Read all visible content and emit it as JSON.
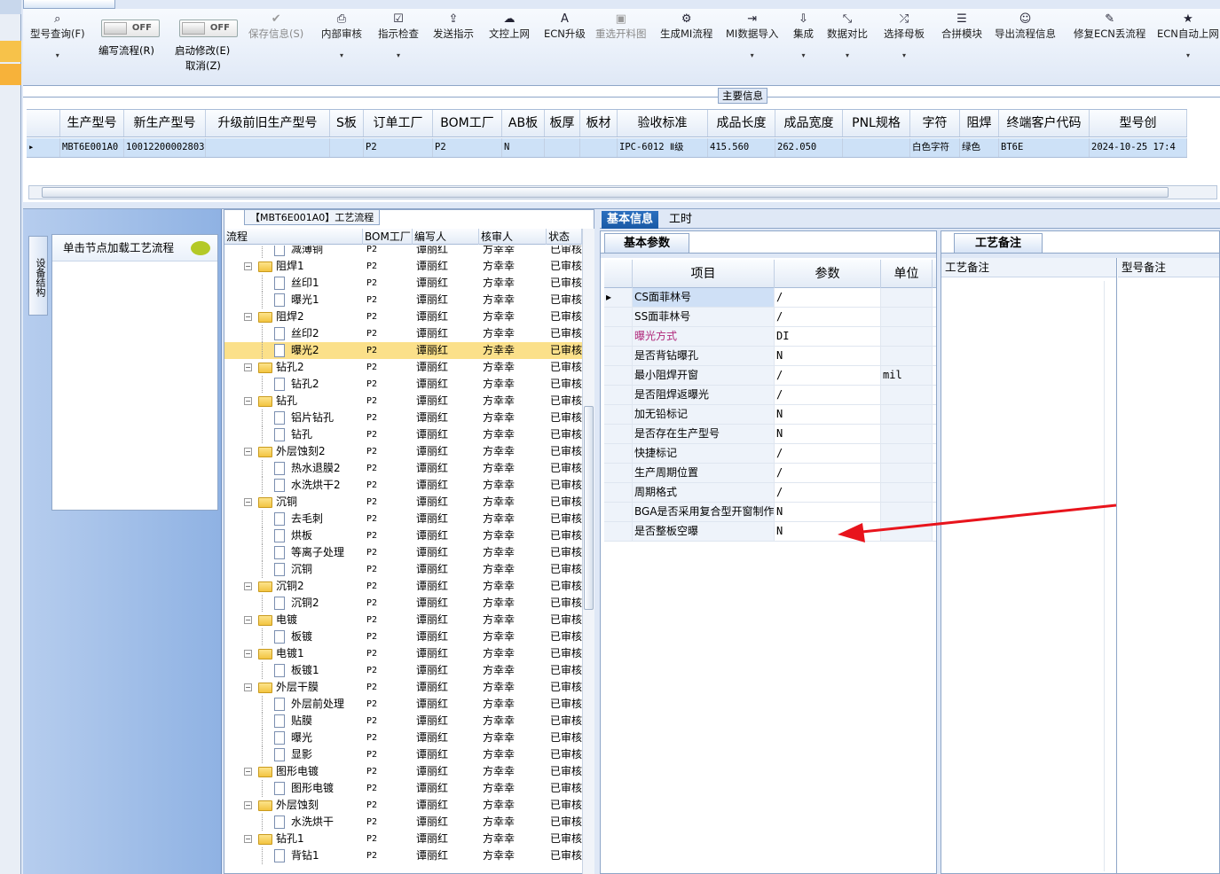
{
  "doc_tab": {
    "title": "",
    "close": "×"
  },
  "toolbar": {
    "items": [
      {
        "label": "型号查询(F)",
        "icon": "search-icon",
        "dropdown": true
      },
      {
        "label": "保存信息(S)",
        "icon": "check-icon",
        "disabled": true
      },
      {
        "label": "内部审核",
        "icon": "print-icon",
        "dropdown": true
      },
      {
        "label": "指示检查",
        "icon": "checkbox-icon",
        "dropdown": true
      },
      {
        "label": "发送指示",
        "icon": "upload-icon"
      },
      {
        "label": "文控上网",
        "icon": "cloud-upload-icon"
      },
      {
        "label": "ECN升级",
        "icon": "font-a-icon"
      },
      {
        "label": "重选开料图",
        "icon": "image-icon",
        "disabled": true
      },
      {
        "label": "生成MI流程",
        "icon": "cogs-icon"
      },
      {
        "label": "MI数据导入",
        "icon": "import-icon",
        "dropdown": true
      },
      {
        "label": "集成",
        "icon": "download-icon",
        "dropdown": true
      },
      {
        "label": "数据对比",
        "icon": "compress-icon",
        "dropdown": true
      },
      {
        "label": "选择母板",
        "icon": "shuffle-icon",
        "dropdown": true
      },
      {
        "label": "合拼模块",
        "icon": "list-icon"
      },
      {
        "label": "导出流程信息",
        "icon": "smile-icon"
      },
      {
        "label": "修复ECN丢流程",
        "icon": "wrench-icon"
      },
      {
        "label": "ECN自动上网",
        "icon": "star-icon",
        "dropdown": true
      }
    ],
    "toggle1": {
      "state": "OFF",
      "label": "编写流程(R)"
    },
    "toggle2": {
      "state": "OFF",
      "label": "启动修改(E)",
      "sublabel": "取消(Z)"
    }
  },
  "main_info": {
    "legend": "主要信息",
    "columns": [
      "生产型号",
      "新生产型号",
      "升级前旧生产型号",
      "S板",
      "订单工厂",
      "BOM工厂",
      "AB板",
      "板厚",
      "板材",
      "验收标准",
      "成品长度",
      "成品宽度",
      "PNL规格",
      "字符",
      "阻焊",
      "终端客户代码",
      "型号创"
    ],
    "row": [
      "MBT6E001A0",
      "10012200002803",
      "",
      "",
      "P2",
      "P2",
      "N",
      "",
      "",
      "IPC-6012 Ⅱ级",
      "415.560",
      "262.050",
      "",
      "白色字符",
      "绿色",
      "BT6E",
      "2024-10-25 17:4"
    ]
  },
  "left_panel": {
    "vtab": "设备结构",
    "node_hint": "单击节点加载工艺流程"
  },
  "flow": {
    "title": "【MBT6E001A0】工艺流程",
    "columns": [
      "流程",
      "BOM工厂",
      "编写人",
      "核审人",
      "状态"
    ],
    "rows": [
      {
        "name": "减薄铜",
        "type": "doc",
        "bom": "P2",
        "writer": "谭丽红",
        "checker": "方幸幸",
        "status": "已审核"
      },
      {
        "name": "阻焊1",
        "type": "folder",
        "bom": "P2",
        "writer": "谭丽红",
        "checker": "方幸幸",
        "status": "已审核"
      },
      {
        "name": "丝印1",
        "type": "doc",
        "bom": "P2",
        "writer": "谭丽红",
        "checker": "方幸幸",
        "status": "已审核"
      },
      {
        "name": "曝光1",
        "type": "doc",
        "bom": "P2",
        "writer": "谭丽红",
        "checker": "方幸幸",
        "status": "已审核"
      },
      {
        "name": "阻焊2",
        "type": "folder",
        "bom": "P2",
        "writer": "谭丽红",
        "checker": "方幸幸",
        "status": "已审核"
      },
      {
        "name": "丝印2",
        "type": "doc",
        "bom": "P2",
        "writer": "谭丽红",
        "checker": "方幸幸",
        "status": "已审核"
      },
      {
        "name": "曝光2",
        "type": "doc",
        "bom": "P2",
        "writer": "谭丽红",
        "checker": "方幸幸",
        "status": "已审核",
        "selected": true
      },
      {
        "name": "钻孔2",
        "type": "folder",
        "bom": "P2",
        "writer": "谭丽红",
        "checker": "方幸幸",
        "status": "已审核"
      },
      {
        "name": "钻孔2",
        "type": "doc",
        "bom": "P2",
        "writer": "谭丽红",
        "checker": "方幸幸",
        "status": "已审核"
      },
      {
        "name": "钻孔",
        "type": "folder",
        "bom": "P2",
        "writer": "谭丽红",
        "checker": "方幸幸",
        "status": "已审核"
      },
      {
        "name": "铝片钻孔",
        "type": "doc",
        "bom": "P2",
        "writer": "谭丽红",
        "checker": "方幸幸",
        "status": "已审核"
      },
      {
        "name": "钻孔",
        "type": "doc",
        "bom": "P2",
        "writer": "谭丽红",
        "checker": "方幸幸",
        "status": "已审核"
      },
      {
        "name": "外层蚀刻2",
        "type": "folder",
        "bom": "P2",
        "writer": "谭丽红",
        "checker": "方幸幸",
        "status": "已审核"
      },
      {
        "name": "热水退膜2",
        "type": "doc",
        "bom": "P2",
        "writer": "谭丽红",
        "checker": "方幸幸",
        "status": "已审核"
      },
      {
        "name": "水洗烘干2",
        "type": "doc",
        "bom": "P2",
        "writer": "谭丽红",
        "checker": "方幸幸",
        "status": "已审核"
      },
      {
        "name": "沉铜",
        "type": "folder",
        "bom": "P2",
        "writer": "谭丽红",
        "checker": "方幸幸",
        "status": "已审核"
      },
      {
        "name": "去毛刺",
        "type": "doc",
        "bom": "P2",
        "writer": "谭丽红",
        "checker": "方幸幸",
        "status": "已审核"
      },
      {
        "name": "烘板",
        "type": "doc",
        "bom": "P2",
        "writer": "谭丽红",
        "checker": "方幸幸",
        "status": "已审核"
      },
      {
        "name": "等离子处理",
        "type": "doc",
        "bom": "P2",
        "writer": "谭丽红",
        "checker": "方幸幸",
        "status": "已审核"
      },
      {
        "name": "沉铜",
        "type": "doc",
        "bom": "P2",
        "writer": "谭丽红",
        "checker": "方幸幸",
        "status": "已审核"
      },
      {
        "name": "沉铜2",
        "type": "folder",
        "bom": "P2",
        "writer": "谭丽红",
        "checker": "方幸幸",
        "status": "已审核"
      },
      {
        "name": "沉铜2",
        "type": "doc",
        "bom": "P2",
        "writer": "谭丽红",
        "checker": "方幸幸",
        "status": "已审核"
      },
      {
        "name": "电镀",
        "type": "folder",
        "bom": "P2",
        "writer": "谭丽红",
        "checker": "方幸幸",
        "status": "已审核"
      },
      {
        "name": "板镀",
        "type": "doc",
        "bom": "P2",
        "writer": "谭丽红",
        "checker": "方幸幸",
        "status": "已审核"
      },
      {
        "name": "电镀1",
        "type": "folder",
        "bom": "P2",
        "writer": "谭丽红",
        "checker": "方幸幸",
        "status": "已审核"
      },
      {
        "name": "板镀1",
        "type": "doc",
        "bom": "P2",
        "writer": "谭丽红",
        "checker": "方幸幸",
        "status": "已审核"
      },
      {
        "name": "外层干膜",
        "type": "folder",
        "bom": "P2",
        "writer": "谭丽红",
        "checker": "方幸幸",
        "status": "已审核"
      },
      {
        "name": "外层前处理",
        "type": "doc",
        "bom": "P2",
        "writer": "谭丽红",
        "checker": "方幸幸",
        "status": "已审核"
      },
      {
        "name": "贴膜",
        "type": "doc",
        "bom": "P2",
        "writer": "谭丽红",
        "checker": "方幸幸",
        "status": "已审核"
      },
      {
        "name": "曝光",
        "type": "doc",
        "bom": "P2",
        "writer": "谭丽红",
        "checker": "方幸幸",
        "status": "已审核"
      },
      {
        "name": "显影",
        "type": "doc",
        "bom": "P2",
        "writer": "谭丽红",
        "checker": "方幸幸",
        "status": "已审核"
      },
      {
        "name": "图形电镀",
        "type": "folder",
        "bom": "P2",
        "writer": "谭丽红",
        "checker": "方幸幸",
        "status": "已审核"
      },
      {
        "name": "图形电镀",
        "type": "doc",
        "bom": "P2",
        "writer": "谭丽红",
        "checker": "方幸幸",
        "status": "已审核"
      },
      {
        "name": "外层蚀刻",
        "type": "folder",
        "bom": "P2",
        "writer": "谭丽红",
        "checker": "方幸幸",
        "status": "已审核"
      },
      {
        "name": "水洗烘干",
        "type": "doc",
        "bom": "P2",
        "writer": "谭丽红",
        "checker": "方幸幸",
        "status": "已审核"
      },
      {
        "name": "钻孔1",
        "type": "folder",
        "bom": "P2",
        "writer": "谭丽红",
        "checker": "方幸幸",
        "status": "已审核"
      },
      {
        "name": "背钻1",
        "type": "doc",
        "bom": "P2",
        "writer": "谭丽红",
        "checker": "方幸幸",
        "status": "已审核"
      }
    ]
  },
  "right_tabs": [
    "基本信息",
    "工时"
  ],
  "basic": {
    "tab": "基本参数",
    "columns": [
      "项目",
      "参数",
      "单位"
    ],
    "rows": [
      {
        "item": "CS面菲林号",
        "param": "/",
        "unit": "",
        "selected": true
      },
      {
        "item": "SS面菲林号",
        "param": "/",
        "unit": ""
      },
      {
        "item": "曝光方式",
        "param": "DI",
        "unit": "",
        "pink": true
      },
      {
        "item": "是否背钻曝孔",
        "param": "N",
        "unit": ""
      },
      {
        "item": "最小阻焊开窗",
        "param": "/",
        "unit": "mil"
      },
      {
        "item": "是否阻焊返曝光",
        "param": "/",
        "unit": ""
      },
      {
        "item": "加无铅标记",
        "param": "N",
        "unit": ""
      },
      {
        "item": "是否存在生产型号",
        "param": "N",
        "unit": ""
      },
      {
        "item": "快捷标记",
        "param": "/",
        "unit": ""
      },
      {
        "item": "生产周期位置",
        "param": "/",
        "unit": ""
      },
      {
        "item": "周期格式",
        "param": "/",
        "unit": ""
      },
      {
        "item": "BGA是否采用复合型开窗制作",
        "param": "N",
        "unit": ""
      },
      {
        "item": "是否整板空曝",
        "param": "N",
        "unit": ""
      }
    ]
  },
  "notes": {
    "tab": "工艺备注",
    "col1": "工艺备注",
    "col2": "型号备注"
  },
  "colors": {
    "selection": "#cde1f7",
    "tree_selected": "#fbe08a",
    "accent_tab": "#1a5aa6",
    "arrow": "#e8141c",
    "pink_text": "#b0287a"
  }
}
